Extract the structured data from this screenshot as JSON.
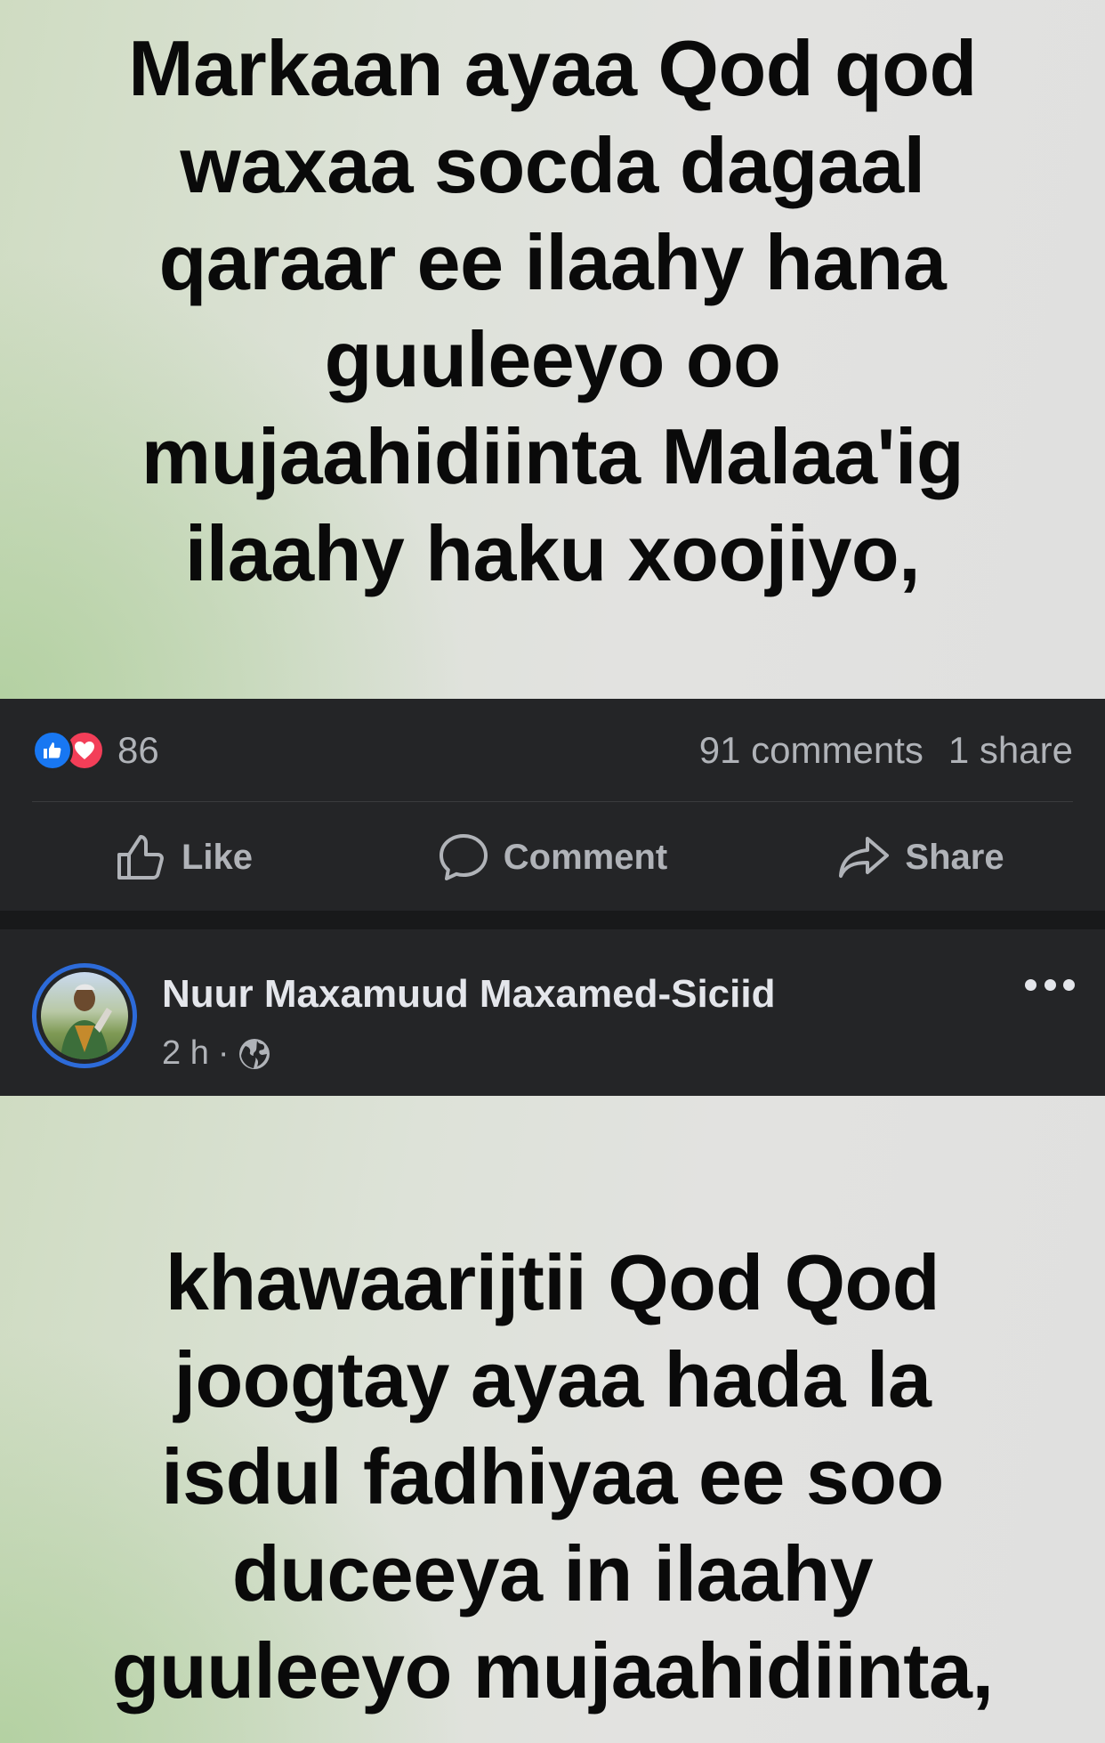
{
  "post1": {
    "text_lines": [
      "Markaan ayaa Qod qod",
      "waxaa socda dagaal",
      "qaraar ee ilaahy hana",
      "guuleeyo oo",
      "mujaahidiinta Malaa'ig",
      "ilaahy haku xoojiyo,"
    ],
    "background_colors": [
      "#b2d0a0",
      "#e0e0df"
    ],
    "reactions": {
      "icons": [
        "like-icon",
        "love-icon"
      ],
      "count": "86"
    },
    "comments": "91 comments",
    "shares": "1 share"
  },
  "actions": {
    "like": "Like",
    "comment": "Comment",
    "share": "Share"
  },
  "post2": {
    "author": "Nuur Maxamuud Maxamed-Siciid",
    "time": "2 h",
    "separator": "·",
    "audience_icon": "globe-icon",
    "text_lines": [
      "khawaarijtii Qod Qod",
      "joogtay ayaa hada la",
      "isdul fadhiyaa ee soo",
      "duceeya in ilaahy",
      "guuleeyo mujaahidiinta,"
    ]
  },
  "colors": {
    "surface": "#242527",
    "feed_bg": "#18191a",
    "primary_text": "#e4e6eb",
    "secondary_text": "#b0b3b8",
    "like_blue": "#1877f2",
    "love_red": "#f33e58",
    "story_ring": "#2d6bd9"
  }
}
